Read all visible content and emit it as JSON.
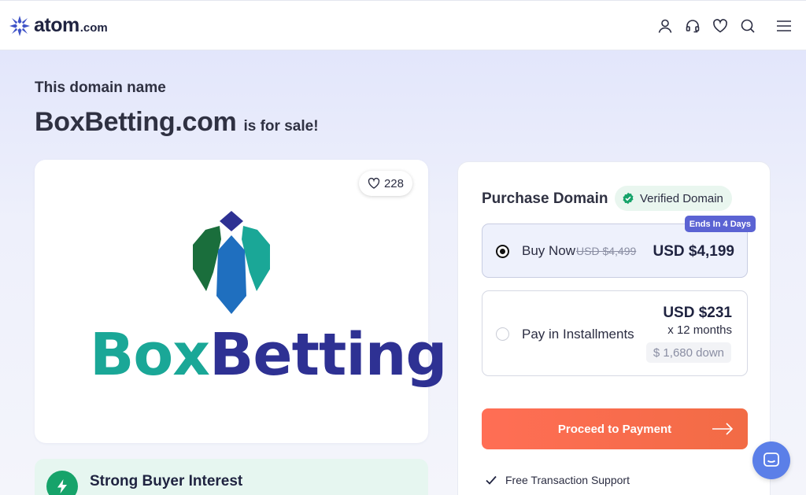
{
  "header": {
    "logo_text": "atom",
    "logo_tld": ".com",
    "icons": [
      "user-icon",
      "support-headset-icon",
      "heart-icon",
      "search-icon",
      "menu-icon"
    ]
  },
  "hero": {
    "eyebrow": "This domain name",
    "domain": "BoxBetting.com",
    "suffix": "is for sale!"
  },
  "logo_card": {
    "likes": "228",
    "brand_part1": "Box",
    "brand_part2": "Betting"
  },
  "interest": {
    "title": "Strong Buyer Interest"
  },
  "purchase": {
    "title": "Purchase Domain",
    "verified_label": "Verified Domain",
    "ends_badge": "Ends In 4 Days",
    "buy_now": {
      "label": "Buy Now",
      "old_price": "USD $4,499",
      "price": "USD $4,199",
      "selected": true
    },
    "installments": {
      "label": "Pay in Installments",
      "price": "USD $231",
      "months": "x 12 months",
      "down": "$ 1,680 down",
      "selected": false
    },
    "proceed_label": "Proceed to Payment",
    "perk": "Free Transaction Support"
  },
  "colors": {
    "accent": "#5b63d3",
    "cta": "#f26b45",
    "verified_green": "#16a36a",
    "brand_teal": "#1aa797",
    "brand_navy": "#2e3193"
  }
}
